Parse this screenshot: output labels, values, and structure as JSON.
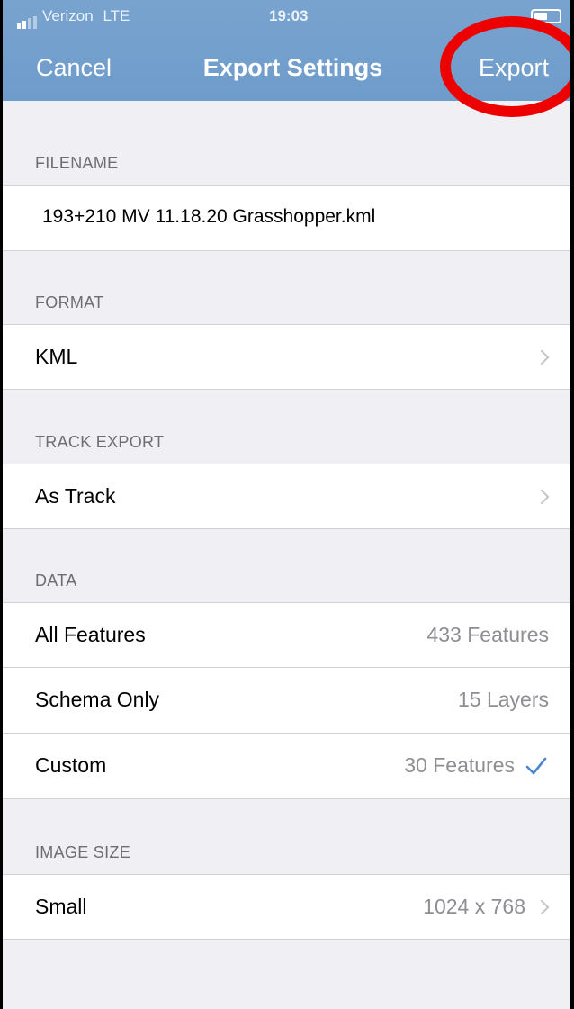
{
  "status_bar": {
    "carrier": "Verizon",
    "network": "LTE",
    "time": "19:03"
  },
  "nav": {
    "cancel_label": "Cancel",
    "title": "Export Settings",
    "export_label": "Export"
  },
  "filename": {
    "header": "FILENAME",
    "value": "193+210 MV 11.18.20 Grasshopper.kml"
  },
  "format": {
    "header": "FORMAT",
    "value": "KML"
  },
  "track_export": {
    "header": "TRACK EXPORT",
    "value": "As Track"
  },
  "data": {
    "header": "DATA",
    "rows": [
      {
        "label": "All Features",
        "value": "433 Features",
        "selected": false
      },
      {
        "label": "Schema Only",
        "value": "15 Layers",
        "selected": false
      },
      {
        "label": "Custom",
        "value": "30 Features",
        "selected": true
      }
    ]
  },
  "image_size": {
    "header": "IMAGE SIZE",
    "label": "Small",
    "value": "1024 x 768"
  },
  "colors": {
    "nav_bar": "#6e9ccb",
    "highlight_ring": "#ec0000",
    "checkmark": "#4a87d0",
    "background": "#efeff4"
  }
}
